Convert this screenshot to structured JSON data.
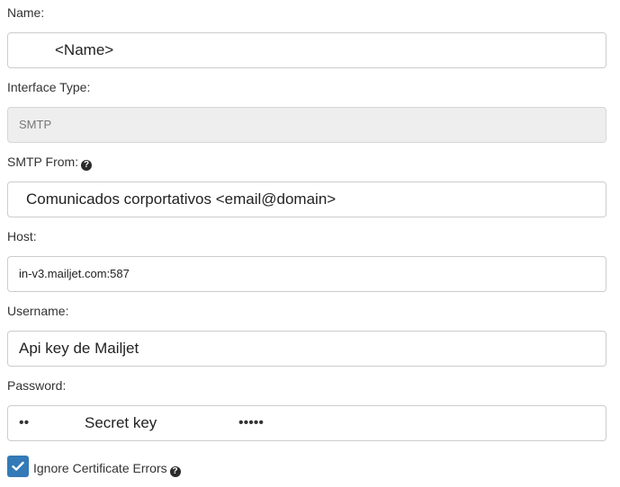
{
  "form": {
    "name": {
      "label": "Name:",
      "value": "<Name>"
    },
    "interface_type": {
      "label": "Interface Type:",
      "value": "SMTP"
    },
    "smtp_from": {
      "label": "SMTP From:",
      "value": "Comunicados corportativos <email@domain>"
    },
    "host": {
      "label": "Host:",
      "value": "in-v3.mailjet.com:587"
    },
    "username": {
      "label": "Username:",
      "value": "Api key de Mailjet"
    },
    "password": {
      "label": "Password:",
      "mask_left": "••",
      "value": "Secret key",
      "mask_right": "•••••"
    },
    "ignore_cert": {
      "label": "Ignore Certificate Errors",
      "checked": true
    }
  },
  "icons": {
    "help": "question-circle-icon",
    "check": "check-icon"
  },
  "colors": {
    "accent": "#337ab7",
    "disabled_bg": "#eeeeee",
    "border": "#cccccc"
  }
}
